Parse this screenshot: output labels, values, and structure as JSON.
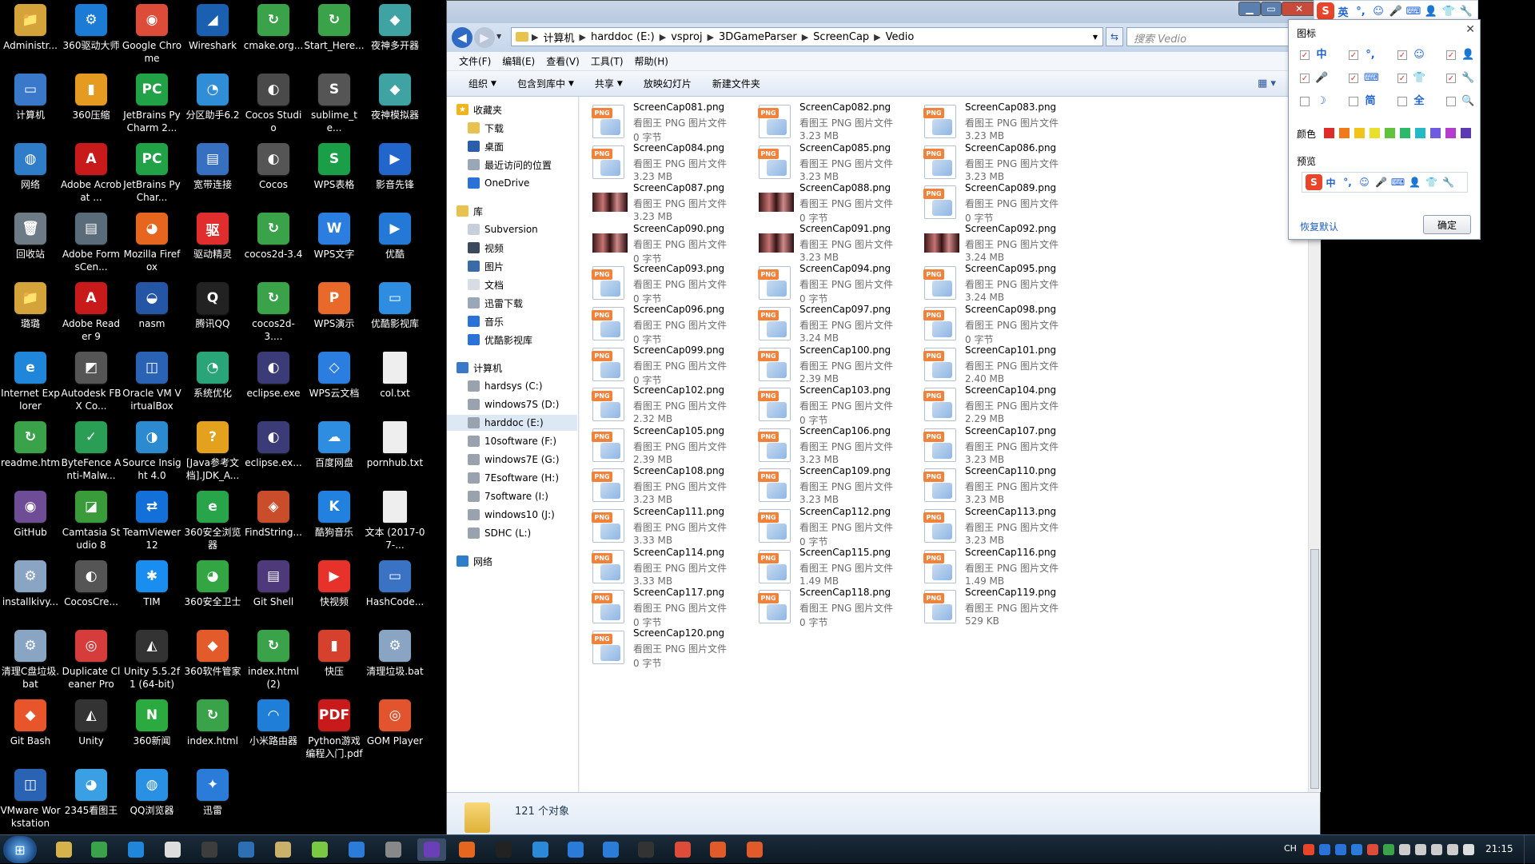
{
  "desktop": {
    "icons": [
      {
        "label": "Administr...",
        "color": "#d4a43a",
        "glyph": "📁"
      },
      {
        "label": "360驱动大师",
        "color": "#1c7bd4",
        "glyph": "⚙"
      },
      {
        "label": "Google Chrome",
        "color": "#dd4b39",
        "glyph": "◉"
      },
      {
        "label": "Wireshark",
        "color": "#1b5fb0",
        "glyph": "◢"
      },
      {
        "label": "cmake.org...",
        "color": "#3aa34a",
        "glyph": "↻"
      },
      {
        "label": "Start_Here...",
        "color": "#3aa34a",
        "glyph": "↻"
      },
      {
        "label": "夜神多开器",
        "color": "#3fa3a3",
        "glyph": "◆"
      },
      {
        "label": "计算机",
        "color": "#3a78c9",
        "glyph": "▭"
      },
      {
        "label": "360压缩",
        "color": "#e59b21",
        "glyph": "▮"
      },
      {
        "label": "JetBrains PyCharm 2...",
        "color": "#21a246",
        "glyph": "PC"
      },
      {
        "label": "分区助手6.2",
        "color": "#2f8ed6",
        "glyph": "◔"
      },
      {
        "label": "Cocos Studio",
        "color": "#4a4a4a",
        "glyph": "◐"
      },
      {
        "label": "sublime_te...",
        "color": "#555",
        "glyph": "S"
      },
      {
        "label": "夜神模拟器",
        "color": "#3fa3a3",
        "glyph": "◆"
      },
      {
        "label": "网络",
        "color": "#2f7cc9",
        "glyph": "◍"
      },
      {
        "label": "Adobe Acrobat ...",
        "color": "#c8191b",
        "glyph": "A"
      },
      {
        "label": "JetBrains PyChar...",
        "color": "#21a246",
        "glyph": "PC"
      },
      {
        "label": "宽带连接",
        "color": "#3770c0",
        "glyph": "▤"
      },
      {
        "label": "Cocos",
        "color": "#555",
        "glyph": "◐"
      },
      {
        "label": "WPS表格",
        "color": "#1a9e48",
        "glyph": "S"
      },
      {
        "label": "影音先锋",
        "color": "#2266cc",
        "glyph": "▶"
      },
      {
        "label": "回收站",
        "color": "#6d7b87",
        "glyph": "🗑"
      },
      {
        "label": "Adobe FormsCen...",
        "color": "#5a6b7a",
        "glyph": "▤"
      },
      {
        "label": "Mozilla Firefox",
        "color": "#e6661f",
        "glyph": "◕"
      },
      {
        "label": "驱动精灵",
        "color": "#e02d2d",
        "glyph": "驱"
      },
      {
        "label": "cocos2d-3.4",
        "color": "#3aa34a",
        "glyph": "↻"
      },
      {
        "label": "WPS文字",
        "color": "#2b7de0",
        "glyph": "W"
      },
      {
        "label": "优酷",
        "color": "#2479d6",
        "glyph": "▶"
      },
      {
        "label": "璐璐",
        "color": "#d4a43a",
        "glyph": "📁"
      },
      {
        "label": "Adobe Reader 9",
        "color": "#c8191b",
        "glyph": "A"
      },
      {
        "label": "nasm",
        "color": "#2456a5",
        "glyph": "◒"
      },
      {
        "label": "腾讯QQ",
        "color": "#222",
        "glyph": "Q"
      },
      {
        "label": "cocos2d-3....",
        "color": "#3aa34a",
        "glyph": "↻"
      },
      {
        "label": "WPS演示",
        "color": "#e8692a",
        "glyph": "P"
      },
      {
        "label": "优酷影视库",
        "color": "#2e8de0",
        "glyph": "▭"
      },
      {
        "label": "Internet Explorer",
        "color": "#1f86d9",
        "glyph": "e"
      },
      {
        "label": "Autodesk FBX Co...",
        "color": "#555",
        "glyph": "◩"
      },
      {
        "label": "Oracle VM VirtualBox",
        "color": "#2a63b3",
        "glyph": "◫"
      },
      {
        "label": "系统优化",
        "color": "#2aa57a",
        "glyph": "◔"
      },
      {
        "label": "eclipse.exe",
        "color": "#3b3b78",
        "glyph": "◐"
      },
      {
        "label": "WPS云文档",
        "color": "#2b7de0",
        "glyph": "◇"
      },
      {
        "label": "col.txt",
        "color": "#eee",
        "glyph": ""
      },
      {
        "label": "readme.htm",
        "color": "#3aa34a",
        "glyph": "↻"
      },
      {
        "label": "ByteFence Anti-Malw...",
        "color": "#2a9e55",
        "glyph": "✓"
      },
      {
        "label": "Source Insight 4.0",
        "color": "#2c8ad1",
        "glyph": "◑"
      },
      {
        "label": "[Java参考文档].JDK_A...",
        "color": "#e3a11d",
        "glyph": "?"
      },
      {
        "label": "eclipse.ex...",
        "color": "#3b3b78",
        "glyph": "◐"
      },
      {
        "label": "百度网盘",
        "color": "#2e8de0",
        "glyph": "☁"
      },
      {
        "label": "pornhub.txt",
        "color": "#eee",
        "glyph": ""
      },
      {
        "label": "GitHub",
        "color": "#6e4c96",
        "glyph": "◉"
      },
      {
        "label": "Camtasia Studio 8",
        "color": "#3a9b3a",
        "glyph": "◪"
      },
      {
        "label": "TeamViewer 12",
        "color": "#1270d8",
        "glyph": "⇄"
      },
      {
        "label": "360安全浏览器",
        "color": "#28a54a",
        "glyph": "e"
      },
      {
        "label": "FindString...",
        "color": "#c94d2a",
        "glyph": "◈"
      },
      {
        "label": "酷狗音乐",
        "color": "#2280df",
        "glyph": "K"
      },
      {
        "label": "文本 (2017-07-...",
        "color": "#eee",
        "glyph": ""
      },
      {
        "label": "installkivy...",
        "color": "#8aa5c4",
        "glyph": "⚙"
      },
      {
        "label": "CocosCre...",
        "color": "#555",
        "glyph": "◐"
      },
      {
        "label": "TIM",
        "color": "#1a8ef0",
        "glyph": "✱"
      },
      {
        "label": "360安全卫士",
        "color": "#33a543",
        "glyph": "◕"
      },
      {
        "label": "Git Shell",
        "color": "#4e3a7a",
        "glyph": "▤"
      },
      {
        "label": "快视频",
        "color": "#e7322b",
        "glyph": "▶"
      },
      {
        "label": "HashCode...",
        "color": "#3a72c4",
        "glyph": "▭"
      },
      {
        "label": "清理C盘垃圾.bat",
        "color": "#8aa5c4",
        "glyph": "⚙"
      },
      {
        "label": "Duplicate Cleaner Pro",
        "color": "#d63c3c",
        "glyph": "◎"
      },
      {
        "label": "Unity 5.5.2f1 (64-bit)",
        "color": "#333",
        "glyph": "◭"
      },
      {
        "label": "360软件管家",
        "color": "#e35b2a",
        "glyph": "◆"
      },
      {
        "label": "index.html (2)",
        "color": "#3aa34a",
        "glyph": "↻"
      },
      {
        "label": "快压",
        "color": "#d6412e",
        "glyph": "▮"
      },
      {
        "label": "清理垃圾.bat",
        "color": "#8aa5c4",
        "glyph": "⚙"
      },
      {
        "label": "Git Bash",
        "color": "#e8552b",
        "glyph": "◆"
      },
      {
        "label": "Unity",
        "color": "#333",
        "glyph": "◭"
      },
      {
        "label": "360新闻",
        "color": "#2aaa3f",
        "glyph": "N"
      },
      {
        "label": "index.html",
        "color": "#3aa34a",
        "glyph": "↻"
      },
      {
        "label": "小米路由器",
        "color": "#1e7ed8",
        "glyph": "◠"
      },
      {
        "label": "Python游戏编程入门.pdf",
        "color": "#c8191b",
        "glyph": "PDF"
      },
      {
        "label": "GOM Player",
        "color": "#e2542d",
        "glyph": "◎"
      },
      {
        "label": "VMware Workstation",
        "color": "#2a63b3",
        "glyph": "◫"
      },
      {
        "label": "2345看图王",
        "color": "#3aa0e3",
        "glyph": "◕"
      },
      {
        "label": "QQ浏览器",
        "color": "#2990e4",
        "glyph": "◍"
      },
      {
        "label": "迅雷",
        "color": "#2a7cd8",
        "glyph": "✦"
      }
    ]
  },
  "window": {
    "search_placeholder": "搜索 Vedio",
    "breadcrumb": [
      "计算机",
      "harddoc (E:)",
      "vsproj",
      "3DGameParser",
      "ScreenCap",
      "Vedio"
    ],
    "menu": [
      "文件(F)",
      "编辑(E)",
      "查看(V)",
      "工具(T)",
      "帮助(H)"
    ],
    "commands": [
      {
        "label": "组织",
        "dropdown": true
      },
      {
        "label": "包含到库中",
        "dropdown": true
      },
      {
        "label": "共享",
        "dropdown": true
      },
      {
        "label": "放映幻灯片",
        "dropdown": false
      },
      {
        "label": "新建文件夹",
        "dropdown": false
      }
    ],
    "status_count": "121 个对象"
  },
  "nav": {
    "favorites_header": "收藏夹",
    "favorites": [
      "下载",
      "桌面",
      "最近访问的位置",
      "OneDrive"
    ],
    "libraries_header": "库",
    "libraries": [
      "Subversion",
      "视频",
      "图片",
      "文档",
      "迅雷下载",
      "音乐",
      "优酷影视库"
    ],
    "computer_header": "计算机",
    "drives": [
      "hardsys (C:)",
      "windows7S (D:)",
      "harddoc (E:)",
      "10software (F:)",
      "windows7E (G:)",
      "7Esoftware (H:)",
      "7software (I:)",
      "windows10 (J:)",
      "SDHC (L:)"
    ],
    "network": "网络",
    "selected_drive": "harddoc (E:)"
  },
  "files": {
    "type_label": "看图王 PNG 图片文件",
    "items": [
      {
        "name": "ScreenCap081.png",
        "size": "0 字节",
        "thumb": "png"
      },
      {
        "name": "ScreenCap082.png",
        "size": "3.23 MB",
        "thumb": "png"
      },
      {
        "name": "ScreenCap083.png",
        "size": "3.23 MB",
        "thumb": "png"
      },
      {
        "name": "ScreenCap084.png",
        "size": "3.23 MB",
        "thumb": "png"
      },
      {
        "name": "ScreenCap085.png",
        "size": "3.23 MB",
        "thumb": "png"
      },
      {
        "name": "ScreenCap086.png",
        "size": "3.23 MB",
        "thumb": "png"
      },
      {
        "name": "ScreenCap087.png",
        "size": "3.23 MB",
        "thumb": "photo"
      },
      {
        "name": "ScreenCap088.png",
        "size": "0 字节",
        "thumb": "photo"
      },
      {
        "name": "ScreenCap089.png",
        "size": "0 字节",
        "thumb": "png"
      },
      {
        "name": "ScreenCap090.png",
        "size": "0 字节",
        "thumb": "photo"
      },
      {
        "name": "ScreenCap091.png",
        "size": "3.23 MB",
        "thumb": "photo"
      },
      {
        "name": "ScreenCap092.png",
        "size": "3.24 MB",
        "thumb": "photo"
      },
      {
        "name": "ScreenCap093.png",
        "size": "0 字节",
        "thumb": "png"
      },
      {
        "name": "ScreenCap094.png",
        "size": "0 字节",
        "thumb": "png"
      },
      {
        "name": "ScreenCap095.png",
        "size": "3.24 MB",
        "thumb": "png"
      },
      {
        "name": "ScreenCap096.png",
        "size": "0 字节",
        "thumb": "png"
      },
      {
        "name": "ScreenCap097.png",
        "size": "3.24 MB",
        "thumb": "png"
      },
      {
        "name": "ScreenCap098.png",
        "size": "0 字节",
        "thumb": "png"
      },
      {
        "name": "ScreenCap099.png",
        "size": "0 字节",
        "thumb": "png"
      },
      {
        "name": "ScreenCap100.png",
        "size": "2.39 MB",
        "thumb": "png"
      },
      {
        "name": "ScreenCap101.png",
        "size": "2.40 MB",
        "thumb": "png"
      },
      {
        "name": "ScreenCap102.png",
        "size": "2.32 MB",
        "thumb": "png"
      },
      {
        "name": "ScreenCap103.png",
        "size": "0 字节",
        "thumb": "png"
      },
      {
        "name": "ScreenCap104.png",
        "size": "2.29 MB",
        "thumb": "png"
      },
      {
        "name": "ScreenCap105.png",
        "size": "2.39 MB",
        "thumb": "png"
      },
      {
        "name": "ScreenCap106.png",
        "size": "3.23 MB",
        "thumb": "png"
      },
      {
        "name": "ScreenCap107.png",
        "size": "3.23 MB",
        "thumb": "png"
      },
      {
        "name": "ScreenCap108.png",
        "size": "3.23 MB",
        "thumb": "png"
      },
      {
        "name": "ScreenCap109.png",
        "size": "3.23 MB",
        "thumb": "png"
      },
      {
        "name": "ScreenCap110.png",
        "size": "3.23 MB",
        "thumb": "png"
      },
      {
        "name": "ScreenCap111.png",
        "size": "3.33 MB",
        "thumb": "png"
      },
      {
        "name": "ScreenCap112.png",
        "size": "0 字节",
        "thumb": "png"
      },
      {
        "name": "ScreenCap113.png",
        "size": "3.23 MB",
        "thumb": "png"
      },
      {
        "name": "ScreenCap114.png",
        "size": "3.33 MB",
        "thumb": "png"
      },
      {
        "name": "ScreenCap115.png",
        "size": "1.49 MB",
        "thumb": "png"
      },
      {
        "name": "ScreenCap116.png",
        "size": "1.49 MB",
        "thumb": "png"
      },
      {
        "name": "ScreenCap117.png",
        "size": "0 字节",
        "thumb": "png"
      },
      {
        "name": "ScreenCap118.png",
        "size": "0 字节",
        "thumb": "png"
      },
      {
        "name": "ScreenCap119.png",
        "size": "529 KB",
        "thumb": "png"
      },
      {
        "name": "ScreenCap120.png",
        "size": "0 字节",
        "thumb": "png"
      }
    ]
  },
  "ime": {
    "bar_items": [
      "S",
      "英",
      "°,",
      "☺",
      "🎤",
      "⌨",
      "👤",
      "👕",
      "🔧"
    ],
    "icons_title": "图标",
    "icon_rows": [
      [
        {
          "checked": true,
          "sym": "中"
        },
        {
          "checked": true,
          "sym": "°,"
        },
        {
          "checked": true,
          "sym": "☺"
        },
        {
          "checked": true,
          "sym": "👤"
        }
      ],
      [
        {
          "checked": true,
          "sym": "🎤"
        },
        {
          "checked": true,
          "sym": "⌨"
        },
        {
          "checked": true,
          "sym": "👕"
        },
        {
          "checked": true,
          "sym": "🔧"
        }
      ],
      [
        {
          "checked": false,
          "sym": "☽"
        },
        {
          "checked": false,
          "sym": "简"
        },
        {
          "checked": false,
          "sym": "全"
        },
        {
          "checked": false,
          "sym": "🔍"
        }
      ]
    ],
    "color_label": "颜色",
    "colors": [
      "#e02b2b",
      "#f07a1a",
      "#f2c318",
      "#e8e02a",
      "#62c23c",
      "#2aba6a",
      "#25b8c6",
      "#6d5ce0",
      "#b63cd0",
      "#5b3bb4"
    ],
    "preview_label": "预览",
    "preview_items": [
      "S",
      "中",
      "°,",
      "☺",
      "🎤",
      "⌨",
      "👤",
      "👕",
      "🔧"
    ],
    "restore": "恢复默认",
    "ok": "确定"
  },
  "tray": {
    "lang": "CH",
    "time": "21:15"
  }
}
